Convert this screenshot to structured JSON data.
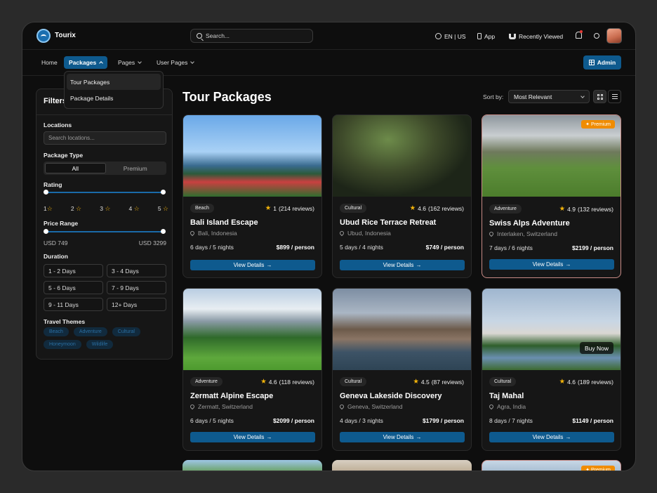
{
  "header": {
    "brand": "Tourix",
    "search_placeholder": "Search...",
    "lang": "EN | US",
    "app": "App",
    "recently_viewed": "Recently Viewed"
  },
  "nav": {
    "items": [
      "Home",
      "Packages",
      "Pages",
      "User Pages"
    ],
    "admin": "Admin",
    "dropdown": [
      "Tour Packages",
      "Package Details"
    ]
  },
  "filters": {
    "title": "Filters",
    "locations_label": "Locations",
    "locations_placeholder": "Search locations...",
    "type_label": "Package Type",
    "type_options": [
      "All",
      "Premium"
    ],
    "rating_label": "Rating",
    "ratings": [
      "1",
      "2",
      "3",
      "4",
      "5"
    ],
    "price_label": "Price Range",
    "price_min": "USD 749",
    "price_max": "USD 3299",
    "duration_label": "Duration",
    "durations": [
      "1 - 2 Days",
      "3 - 4 Days",
      "5 - 6 Days",
      "7 - 9 Days",
      "9 - 11 Days",
      "12+ Days"
    ],
    "themes_label": "Travel Themes",
    "themes": [
      "Beach",
      "Adventure",
      "Cultural",
      "Honeymoon",
      "Wildlife"
    ]
  },
  "main": {
    "title": "Tour Packages",
    "sort_label": "Sort by:",
    "sort_value": "Most Relevant",
    "premium_label": "Premium",
    "buy_now": "Buy Now",
    "view_details": "View Details",
    "cards": [
      {
        "category": "Beach",
        "rating": "1",
        "reviews": "(214 reviews)",
        "title": "Bali Island Escape",
        "location": "Bali, Indonesia",
        "duration": "6 days / 5 nights",
        "price": "$899 / person"
      },
      {
        "category": "Cultural",
        "rating": "4.6",
        "reviews": "(162 reviews)",
        "title": "Ubud Rice Terrace Retreat",
        "location": "Ubud, Indonesia",
        "duration": "5 days / 4 nights",
        "price": "$749 / person"
      },
      {
        "category": "Adventure",
        "rating": "4.9",
        "reviews": "(132 reviews)",
        "title": "Swiss Alps Adventure",
        "location": "Interlaken, Switzerland",
        "duration": "7 days / 6 nights",
        "price": "$2199 / person"
      },
      {
        "category": "Adventure",
        "rating": "4.6",
        "reviews": "(118 reviews)",
        "title": "Zermatt Alpine Escape",
        "location": "Zermatt, Switzerland",
        "duration": "6 days / 5 nights",
        "price": "$2099 / person"
      },
      {
        "category": "Cultural",
        "rating": "4.5",
        "reviews": "(87 reviews)",
        "title": "Geneva Lakeside Discovery",
        "location": "Geneva, Switzerland",
        "duration": "4 days / 3 nights",
        "price": "$1799 / person"
      },
      {
        "category": "Cultural",
        "rating": "4.6",
        "reviews": "(189 reviews)",
        "title": "Taj Mahal",
        "location": "Agra, India",
        "duration": "8 days / 7 nights",
        "price": "$1149 / person"
      }
    ]
  },
  "colors": {
    "accent": "#0e5a8e",
    "star": "#f5b50a",
    "premium": "#f08c00"
  }
}
